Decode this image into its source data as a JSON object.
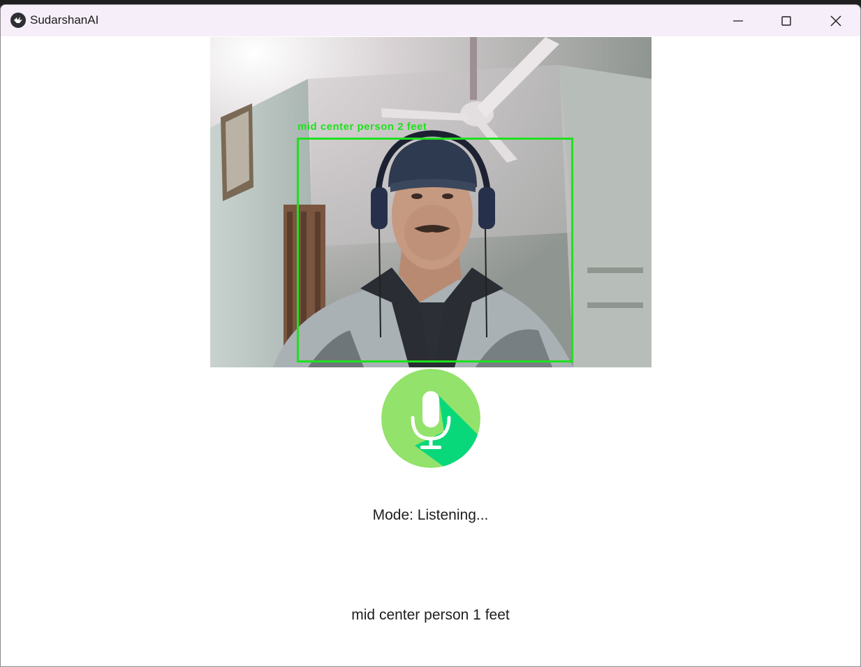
{
  "window": {
    "title": "SudarshanAI",
    "icon": "kivy-logo-icon"
  },
  "titlebar_buttons": {
    "minimize": "minimize-icon",
    "maximize": "maximize-icon",
    "close": "close-icon"
  },
  "camera": {
    "detection_label": "mid center person 2 feet",
    "box_color": "#1fe01f"
  },
  "mic": {
    "icon": "microphone-icon",
    "circle_color": "#93e26b",
    "shadow_color": "#08d87a"
  },
  "status": {
    "mode": "Mode: Listening...",
    "result": "mid center person 1 feet"
  }
}
